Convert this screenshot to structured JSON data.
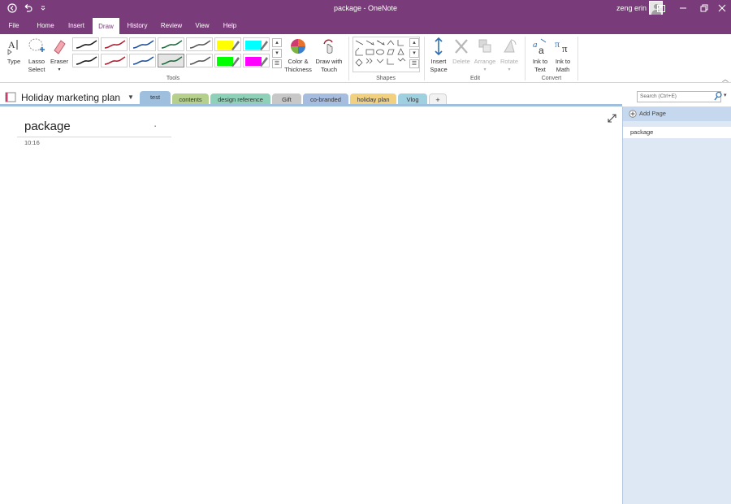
{
  "window": {
    "title": "package  -  OneNote",
    "user": "zeng erin"
  },
  "menu": {
    "tabs": [
      "File",
      "Home",
      "Insert",
      "Draw",
      "History",
      "Review",
      "View",
      "Help"
    ],
    "active": "Draw"
  },
  "ribbon": {
    "tools": {
      "type_label": "Type",
      "lasso_label": "Lasso Select",
      "eraser_label": "Eraser",
      "group_label": "Tools"
    },
    "color_thickness_label": "Color & Thickness",
    "draw_touch_label": "Draw with Touch",
    "shapes_group_label": "Shapes",
    "edit": {
      "insert_space_label": "Insert Space",
      "delete_label": "Delete",
      "arrange_label": "Arrange",
      "rotate_label": "Rotate",
      "group_label": "Edit"
    },
    "convert": {
      "ink_to_text_label": "Ink to Text",
      "ink_to_math_label": "Ink to Math",
      "group_label": "Convert"
    },
    "pen_colors": [
      "#1a1a1a",
      "#b01c2e",
      "#1f4e9c",
      "#1d6b3a",
      "#555555",
      "#ffff00",
      "#00ffff",
      "#1a1a1a",
      "#b01c2e",
      "#1f4e9c",
      "#1d6b3a",
      "#555555",
      "#00ff00",
      "#ff00ff"
    ]
  },
  "notebook": {
    "name": "Holiday marketing plan",
    "sections": [
      {
        "label": "test",
        "color": "#9fbfdf"
      },
      {
        "label": "contents",
        "color": "#b5d08c"
      },
      {
        "label": "design reference",
        "color": "#8fd0b8"
      },
      {
        "label": "Gift",
        "color": "#c8c8c8"
      },
      {
        "label": "co-branded",
        "color": "#a7bde0"
      },
      {
        "label": "holiday plan",
        "color": "#f1d080"
      },
      {
        "label": "Vlog",
        "color": "#9fd0e0"
      }
    ],
    "add_section": "+",
    "search_placeholder": "Search (Ctrl+E)"
  },
  "page": {
    "title": "package",
    "time": "10:16"
  },
  "pages_panel": {
    "add_page_label": "Add Page",
    "items": [
      "package"
    ]
  }
}
